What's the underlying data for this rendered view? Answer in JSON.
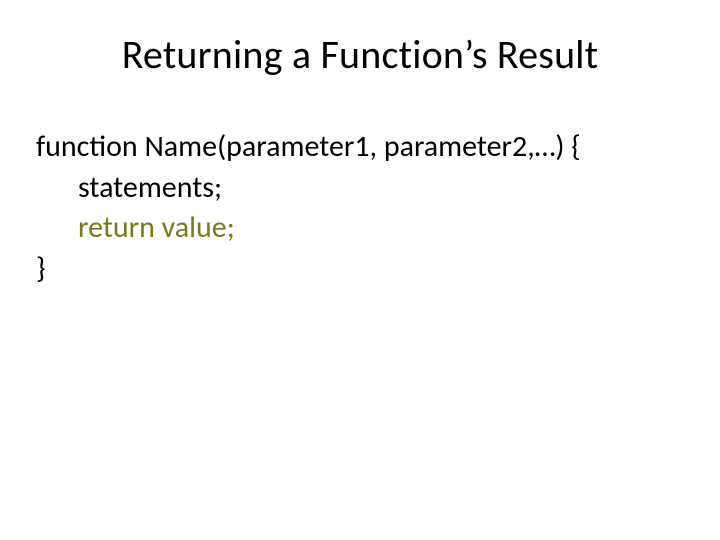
{
  "slide": {
    "title": "Returning a Function’s Result",
    "code": {
      "line1": "function Name(parameter1, parameter2,…) {",
      "line2": "statements;",
      "line3": "return value;",
      "line4": "}"
    }
  }
}
